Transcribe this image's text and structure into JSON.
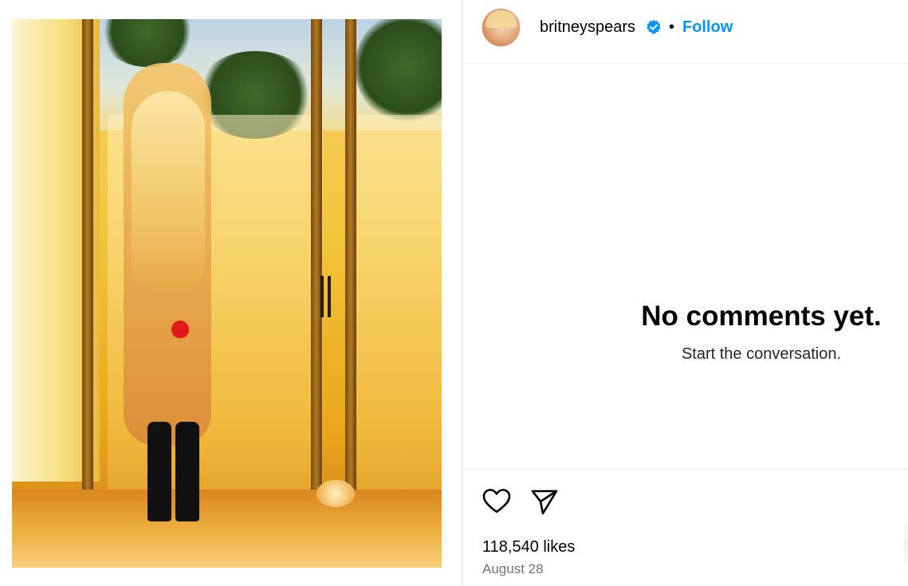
{
  "post": {
    "media": {
      "alt_icon": "photo-icon"
    },
    "author": {
      "username": "britneyspears",
      "verified": true,
      "verified_icon": "verified-badge-icon",
      "separator": "•",
      "follow_label": "Follow"
    },
    "comments": {
      "empty_title": "No comments yet.",
      "empty_subtitle": "Start the conversation."
    },
    "actions": {
      "like_icon": "heart-icon",
      "share_icon": "paper-plane-icon"
    },
    "likes_text": "118,540 likes",
    "date_text": "August 28"
  },
  "colors": {
    "accent": "#0095f6",
    "verified": "#0095f6",
    "muted_text": "#737373",
    "divider": "#dbdbdb"
  }
}
